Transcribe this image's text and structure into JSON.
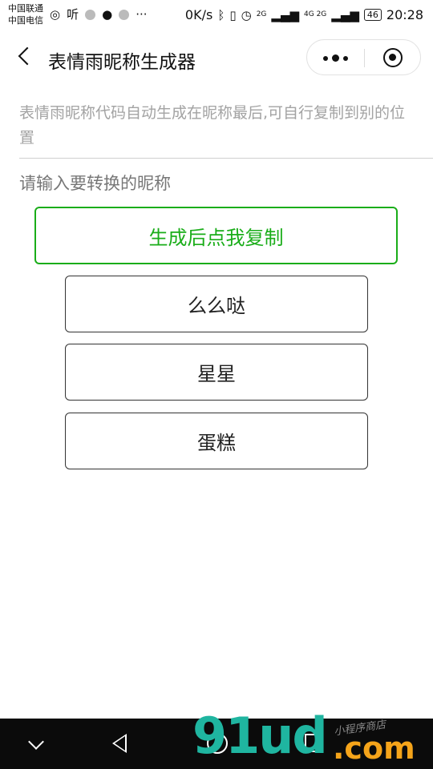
{
  "status_bar": {
    "carrier_1": "中国联通",
    "carrier_2": "中国电信",
    "net_speed": "0K/s",
    "signal_1": "2G",
    "signal_2": "4G 2G",
    "battery": "46",
    "time": "20:28"
  },
  "navbar": {
    "back_icon": "chevron-left-icon",
    "title": "表情雨昵称生成器",
    "more_icon": "more-dots-icon",
    "close_icon": "target-close-icon"
  },
  "main": {
    "hint": "表情雨昵称代码自动生成在昵称最后,可自行复制到别的位置",
    "input_placeholder": "请输入要转换的昵称",
    "copy_button": "生成后点我复制",
    "accent_color": "#1aad19",
    "options": [
      {
        "label": "么么哒"
      },
      {
        "label": "星星"
      },
      {
        "label": "蛋糕"
      }
    ]
  },
  "watermark": {
    "logo": "91ud",
    "domain": ".com",
    "tagline": "小程序商店"
  }
}
